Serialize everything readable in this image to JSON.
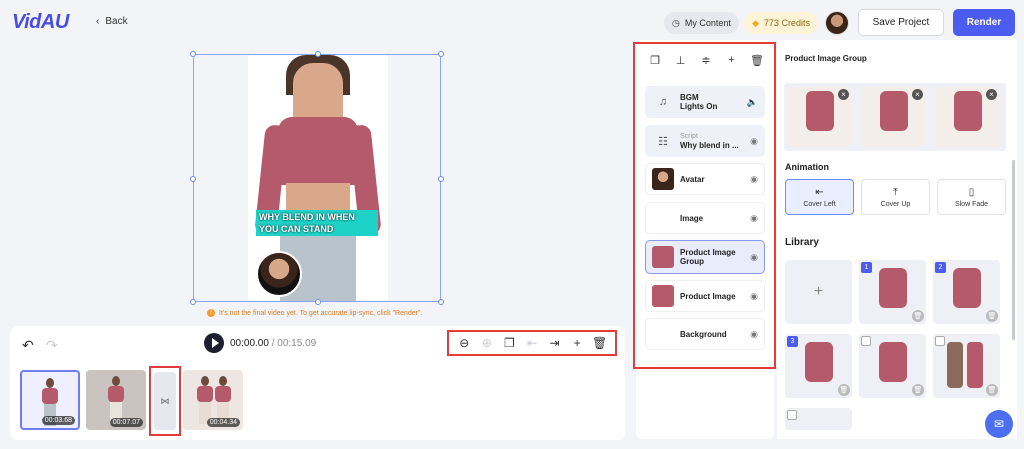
{
  "header": {
    "logo": "VidAU",
    "back_label": "Back",
    "my_content_label": "My Content",
    "credits_label": "773 Credits",
    "save_label": "Save Project",
    "render_label": "Render"
  },
  "preview": {
    "caption": "WHY BLEND IN WHEN YOU CAN STAND",
    "notice": "It's not the final video yet. To get accurate lip-sync, click \"Render\"."
  },
  "timeline": {
    "current_time": "00:00.00",
    "separator": " / ",
    "total_time": "00:15.09",
    "clips": [
      {
        "duration": "00:03.68"
      },
      {
        "duration": "00:07.07"
      },
      {
        "duration": "00:04.34"
      }
    ]
  },
  "layers": [
    {
      "sub": "BGM",
      "label": "Lights On"
    },
    {
      "sub": "Script",
      "label": "Why blend in ..."
    },
    {
      "sub": "",
      "label": "Avatar"
    },
    {
      "sub": "",
      "label": "Image"
    },
    {
      "sub": "",
      "label": "Product Image Group"
    },
    {
      "sub": "",
      "label": "Product Image"
    },
    {
      "sub": "",
      "label": "Background"
    }
  ],
  "properties": {
    "title": "Product Image Group",
    "animation_heading": "Animation",
    "animation_options": [
      "Cover Left",
      "Cover Up",
      "Slow Fade"
    ],
    "selected_animation": "Cover Left",
    "library_heading": "Library",
    "library_numbers": [
      "1",
      "2",
      "3"
    ]
  },
  "colors": {
    "accent": "#4c5cf0",
    "highlight_box": "#e53b3b",
    "caption_bg": "#1fd2c8",
    "product_top": "#b55a6a"
  }
}
